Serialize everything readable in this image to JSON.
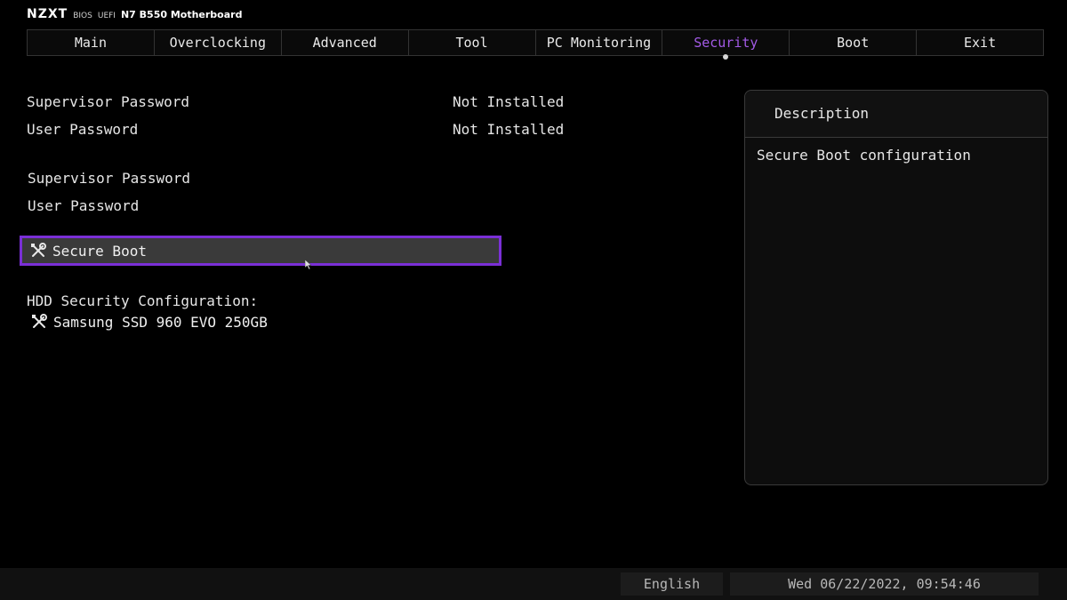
{
  "header": {
    "brand": "NZXT",
    "bios_label": "BIOS",
    "uefi_label": "UEFI",
    "model": "N7 B550 Motherboard"
  },
  "tabs": [
    {
      "label": "Main"
    },
    {
      "label": "Overclocking"
    },
    {
      "label": "Advanced"
    },
    {
      "label": "Tool"
    },
    {
      "label": "PC Monitoring"
    },
    {
      "label": "Security"
    },
    {
      "label": "Boot"
    },
    {
      "label": "Exit"
    }
  ],
  "active_tab": "Security",
  "status": {
    "supervisor_password_label": "Supervisor Password",
    "supervisor_password_value": "Not Installed",
    "user_password_label": "User Password",
    "user_password_value": "Not Installed"
  },
  "settings": {
    "supervisor_password": "Supervisor Password",
    "user_password": "User Password"
  },
  "selected_item": {
    "label": "Secure Boot",
    "icon": "tools-icon"
  },
  "hdd": {
    "heading": "HDD Security Configuration:",
    "device": "Samsung SSD 960 EVO 250GB",
    "icon": "tools-icon"
  },
  "description": {
    "title": "Description",
    "text": "Secure Boot configuration"
  },
  "footer": {
    "language": "English",
    "datetime": "Wed 06/22/2022, 09:54:46"
  },
  "colors": {
    "accent": "#a35ae6",
    "selection_border": "#7a2fd6",
    "selection_fill": "#3a3a3a"
  }
}
